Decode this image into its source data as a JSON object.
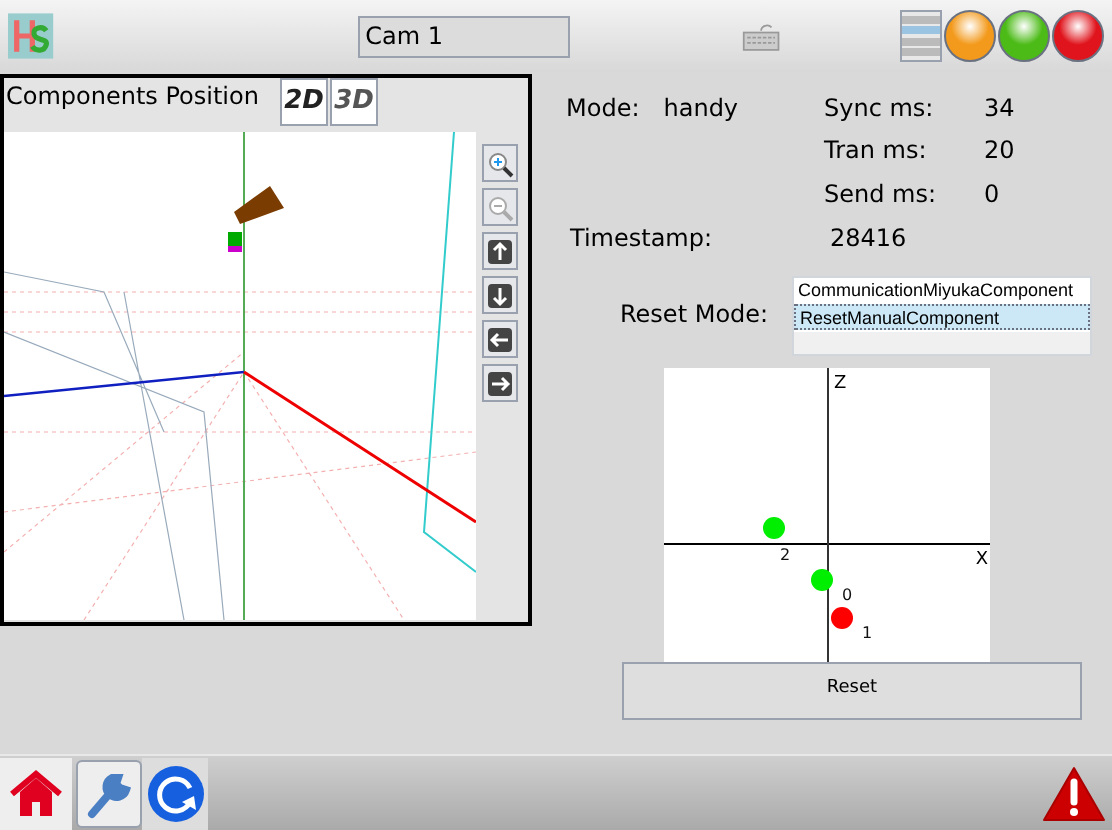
{
  "title_field": {
    "value": "Cam 1"
  },
  "lights": [
    {
      "color": "#f39a1c"
    },
    {
      "color": "#4cbb17"
    },
    {
      "color": "#e0141c"
    }
  ],
  "view_panel": {
    "title": "Components Position",
    "view_modes": [
      {
        "label": "2D"
      },
      {
        "label": "3D"
      }
    ]
  },
  "info": {
    "mode_label": "Mode:",
    "mode_value": "handy",
    "stats": [
      {
        "label": "Sync ms:",
        "value": "34"
      },
      {
        "label": "Tran ms:",
        "value": "20"
      },
      {
        "label": "Send ms:",
        "value": "0"
      }
    ],
    "timestamp_label": "Timestamp:",
    "timestamp_value": "28416"
  },
  "reset_mode": {
    "label": "Reset Mode:",
    "options": [
      {
        "label": "CommunicationMiyukaComponent",
        "selected": false
      },
      {
        "label": "ResetManualComponent",
        "selected": true
      }
    ]
  },
  "plot": {
    "axis_z": "Z",
    "axis_x": "X",
    "points": [
      {
        "label": "2",
        "color": "#00ee00"
      },
      {
        "label": "0",
        "color": "#00ee00"
      },
      {
        "label": "1",
        "color": "#ff0000"
      }
    ]
  },
  "reset_button": "Reset"
}
